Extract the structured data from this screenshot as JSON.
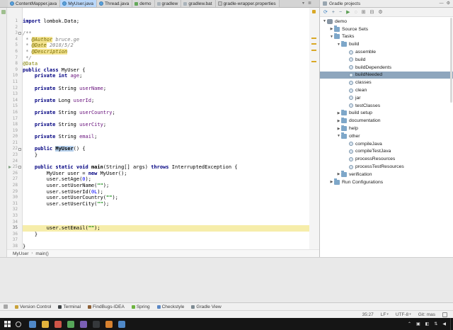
{
  "colors": {
    "selected_tab": "#b9d7fa",
    "tree_selection": "#8ea6bd",
    "current_line": "#f6edaa",
    "warning_stripe": "#d9a826"
  },
  "editor_tabs": {
    "items": [
      {
        "label": "ContentMapper.java",
        "icon": "class-icon",
        "selected": false
      },
      {
        "label": "MyUser.java",
        "icon": "class-icon",
        "selected": true
      },
      {
        "label": "Thread.java",
        "icon": "class-icon",
        "selected": false
      },
      {
        "label": "demo",
        "icon": "file-icon-green",
        "selected": false
      },
      {
        "label": "gradlew",
        "icon": "gradle-file-icon",
        "selected": false
      },
      {
        "label": "gradlew.bat",
        "icon": "gradle-file-icon",
        "selected": false
      },
      {
        "label": "gradle-wrapper.properties",
        "icon": "properties-file-icon",
        "selected": false
      }
    ],
    "extra_icons": [
      {
        "name": "hidden-tabs-list-icon",
        "glyph": "▾"
      },
      {
        "name": "editor-options-icon",
        "glyph": "≣"
      }
    ]
  },
  "editor": {
    "current_line_number": 35,
    "fold_lines": [
      3,
      22,
      25
    ],
    "run_arrow_line": 25,
    "warning_lines": [
      4,
      5,
      6,
      8
    ],
    "breadcrumb": [
      "MyUser",
      "main()"
    ],
    "lines": [
      {
        "parts": [
          [
            "k",
            "import"
          ],
          [
            "p",
            " lombok.Data;"
          ]
        ]
      },
      {
        "parts": []
      },
      {
        "parts": [
          [
            "c",
            "/**"
          ]
        ]
      },
      {
        "parts": [
          [
            "c",
            " * "
          ],
          [
            "t",
            "@Author"
          ],
          [
            "c",
            " bruce.ge"
          ]
        ]
      },
      {
        "parts": [
          [
            "c",
            " * "
          ],
          [
            "t",
            "@Date"
          ],
          [
            "c",
            " 2018/5/2"
          ]
        ]
      },
      {
        "parts": [
          [
            "c",
            " * "
          ],
          [
            "t",
            "@Description"
          ]
        ]
      },
      {
        "parts": [
          [
            "c",
            " */"
          ]
        ]
      },
      {
        "parts": [
          [
            "a",
            "@Data"
          ]
        ]
      },
      {
        "parts": [
          [
            "k",
            "public class "
          ],
          [
            "p",
            "MyUser {"
          ]
        ]
      },
      {
        "parts": [
          [
            "p",
            "    "
          ],
          [
            "k",
            "private int "
          ],
          [
            "f",
            "age"
          ],
          [
            "p",
            ";"
          ]
        ]
      },
      {
        "parts": []
      },
      {
        "parts": [
          [
            "p",
            "    "
          ],
          [
            "k",
            "private "
          ],
          [
            "p",
            "String "
          ],
          [
            "f",
            "userName"
          ],
          [
            "p",
            ";"
          ]
        ]
      },
      {
        "parts": []
      },
      {
        "parts": [
          [
            "p",
            "    "
          ],
          [
            "k",
            "private "
          ],
          [
            "p",
            "Long "
          ],
          [
            "f",
            "userId"
          ],
          [
            "p",
            ";"
          ]
        ]
      },
      {
        "parts": []
      },
      {
        "parts": [
          [
            "p",
            "    "
          ],
          [
            "k",
            "private "
          ],
          [
            "p",
            "String "
          ],
          [
            "f",
            "userCountry"
          ],
          [
            "p",
            ";"
          ]
        ]
      },
      {
        "parts": []
      },
      {
        "parts": [
          [
            "p",
            "    "
          ],
          [
            "k",
            "private "
          ],
          [
            "p",
            "String "
          ],
          [
            "f",
            "userCity"
          ],
          [
            "p",
            ";"
          ]
        ]
      },
      {
        "parts": []
      },
      {
        "parts": [
          [
            "p",
            "    "
          ],
          [
            "k",
            "private "
          ],
          [
            "p",
            "String "
          ],
          [
            "f",
            "email"
          ],
          [
            "p",
            ";"
          ]
        ]
      },
      {
        "parts": []
      },
      {
        "parts": [
          [
            "p",
            "    "
          ],
          [
            "k",
            "public "
          ],
          [
            "h",
            "MyUser"
          ],
          [
            "p",
            "() {"
          ]
        ]
      },
      {
        "parts": [
          [
            "p",
            "    }"
          ]
        ]
      },
      {
        "parts": []
      },
      {
        "parts": [
          [
            "p",
            "    "
          ],
          [
            "k",
            "public static void "
          ],
          [
            "m",
            "main"
          ],
          [
            "p",
            "(String[] args) "
          ],
          [
            "k",
            "throws "
          ],
          [
            "p",
            "InterruptedException {"
          ]
        ]
      },
      {
        "parts": [
          [
            "p",
            "        MyUser user = "
          ],
          [
            "k",
            "new "
          ],
          [
            "p",
            "MyUser();"
          ]
        ]
      },
      {
        "parts": [
          [
            "p",
            "        user.setAge("
          ],
          [
            "n",
            "0"
          ],
          [
            "p",
            ");"
          ]
        ]
      },
      {
        "parts": [
          [
            "p",
            "        user.setUserName("
          ],
          [
            "s",
            "\"\""
          ],
          [
            "p",
            ");"
          ]
        ]
      },
      {
        "parts": [
          [
            "p",
            "        user.setUserId("
          ],
          [
            "n",
            "0L"
          ],
          [
            "p",
            ");"
          ]
        ]
      },
      {
        "parts": [
          [
            "p",
            "        user.setUserCountry("
          ],
          [
            "s",
            "\"\""
          ],
          [
            "p",
            ");"
          ]
        ]
      },
      {
        "parts": [
          [
            "p",
            "        user.setUserCity("
          ],
          [
            "s",
            "\"\""
          ],
          [
            "p",
            ");"
          ]
        ]
      },
      {
        "parts": []
      },
      {
        "parts": []
      },
      {
        "parts": []
      },
      {
        "parts": [
          [
            "p",
            "        user.setEmail("
          ],
          [
            "s",
            "\"\""
          ],
          [
            "p",
            ");"
          ]
        ],
        "current": true
      },
      {
        "parts": [
          [
            "p",
            "    }"
          ]
        ]
      },
      {
        "parts": []
      },
      {
        "parts": [
          [
            "p",
            "}"
          ]
        ]
      }
    ]
  },
  "gradle_panel": {
    "title": "Gradle projects",
    "toolbar_icons": [
      {
        "name": "refresh-icon",
        "glyph": "⟳",
        "color": "#3a7fc1"
      },
      {
        "name": "attach-project-icon",
        "glyph": "+",
        "color": "#5c7b94"
      },
      {
        "name": "detach-project-icon",
        "glyph": "−",
        "color": "#5c7b94"
      },
      {
        "name": "run-task-icon",
        "glyph": "▶",
        "color": "#5a9e52"
      },
      {
        "name": "offline-mode-icon",
        "glyph": "◌",
        "color": "#8a8a8a"
      },
      {
        "name": "expand-all-icon",
        "glyph": "⊞",
        "color": "#6a6a6a"
      },
      {
        "name": "collapse-all-icon",
        "glyph": "⊟",
        "color": "#6a6a6a"
      },
      {
        "name": "settings-gear-icon",
        "glyph": "⚙",
        "color": "#6a6a6a"
      }
    ],
    "header_icons": [
      {
        "name": "hide-panel-icon",
        "glyph": "—"
      },
      {
        "name": "panel-settings-icon",
        "glyph": "⚙"
      }
    ],
    "tree": [
      {
        "label": "demo",
        "level": 0,
        "arrow": "expanded",
        "icon": "project-icon",
        "selected": false
      },
      {
        "label": "Source Sets",
        "level": 1,
        "arrow": "collapsed",
        "icon": "folder-icon",
        "selected": false
      },
      {
        "label": "Tasks",
        "level": 1,
        "arrow": "expanded",
        "icon": "folder-icon",
        "selected": false
      },
      {
        "label": "build",
        "level": 2,
        "arrow": "expanded",
        "icon": "folder-icon",
        "selected": false
      },
      {
        "label": "assemble",
        "level": 3,
        "arrow": "none",
        "icon": "task-icon",
        "selected": false
      },
      {
        "label": "build",
        "level": 3,
        "arrow": "none",
        "icon": "task-icon",
        "selected": false
      },
      {
        "label": "buildDependents",
        "level": 3,
        "arrow": "none",
        "icon": "task-icon",
        "selected": false
      },
      {
        "label": "buildNeeded",
        "level": 3,
        "arrow": "none",
        "icon": "task-icon",
        "selected": true
      },
      {
        "label": "classes",
        "level": 3,
        "arrow": "none",
        "icon": "task-icon",
        "selected": false
      },
      {
        "label": "clean",
        "level": 3,
        "arrow": "none",
        "icon": "task-icon",
        "selected": false
      },
      {
        "label": "jar",
        "level": 3,
        "arrow": "none",
        "icon": "task-icon",
        "selected": false
      },
      {
        "label": "testClasses",
        "level": 3,
        "arrow": "none",
        "icon": "task-icon",
        "selected": false
      },
      {
        "label": "build setup",
        "level": 2,
        "arrow": "collapsed",
        "icon": "folder-icon",
        "selected": false
      },
      {
        "label": "documentation",
        "level": 2,
        "arrow": "collapsed",
        "icon": "folder-icon",
        "selected": false
      },
      {
        "label": "help",
        "level": 2,
        "arrow": "collapsed",
        "icon": "folder-icon",
        "selected": false
      },
      {
        "label": "other",
        "level": 2,
        "arrow": "expanded",
        "icon": "folder-icon",
        "selected": false
      },
      {
        "label": "compileJava",
        "level": 3,
        "arrow": "none",
        "icon": "task-icon",
        "selected": false
      },
      {
        "label": "compileTestJava",
        "level": 3,
        "arrow": "none",
        "icon": "task-icon",
        "selected": false
      },
      {
        "label": "processResources",
        "level": 3,
        "arrow": "none",
        "icon": "task-icon",
        "selected": false
      },
      {
        "label": "processTestResources",
        "level": 3,
        "arrow": "none",
        "icon": "task-icon",
        "selected": false
      },
      {
        "label": "verification",
        "level": 2,
        "arrow": "collapsed",
        "icon": "folder-icon",
        "selected": false
      },
      {
        "label": "Run Configurations",
        "level": 1,
        "arrow": "collapsed",
        "icon": "folder-icon",
        "selected": false
      }
    ]
  },
  "bottom_tool_bar": {
    "items": [
      {
        "label": "Version Control",
        "icon": "version-control-icon",
        "color": "#c9a23a"
      },
      {
        "label": "Terminal",
        "icon": "terminal-icon",
        "color": "#3f4447"
      },
      {
        "label": "FindBugs-IDEA",
        "icon": "findbugs-icon",
        "color": "#8d5f35"
      },
      {
        "label": "Spring",
        "icon": "spring-icon",
        "color": "#6db33f"
      },
      {
        "label": "Checkstyle",
        "icon": "checkstyle-icon",
        "color": "#5a87c5"
      },
      {
        "label": "Gradle View",
        "icon": "gradle-view-icon",
        "color": "#7e8b93"
      }
    ]
  },
  "status_bar": {
    "caret_position": "35:27",
    "line_separator": "LF",
    "encoding": "UTF-8",
    "vcs_branch": "Git: mas"
  },
  "taskbar": {
    "apps": [
      {
        "name": "app-icon-1",
        "color": "#4f88c7"
      },
      {
        "name": "app-icon-2",
        "color": "#e2b33c"
      },
      {
        "name": "app-icon-3",
        "color": "#cf5548"
      },
      {
        "name": "app-icon-4",
        "color": "#57a65a"
      },
      {
        "name": "app-icon-5",
        "color": "#7a5fb5"
      },
      {
        "name": "app-icon-6",
        "color": "#35383b"
      },
      {
        "name": "app-icon-7",
        "color": "#d6812f"
      },
      {
        "name": "app-icon-8",
        "color": "#4f88c7"
      }
    ],
    "tray": [
      {
        "name": "tray-expand-icon",
        "glyph": "⌃"
      },
      {
        "name": "tray-app-icon-1",
        "glyph": "▣"
      },
      {
        "name": "tray-app-icon-2",
        "glyph": "◧"
      },
      {
        "name": "network-icon",
        "glyph": "⇅"
      },
      {
        "name": "volume-icon",
        "glyph": "◀"
      }
    ]
  }
}
